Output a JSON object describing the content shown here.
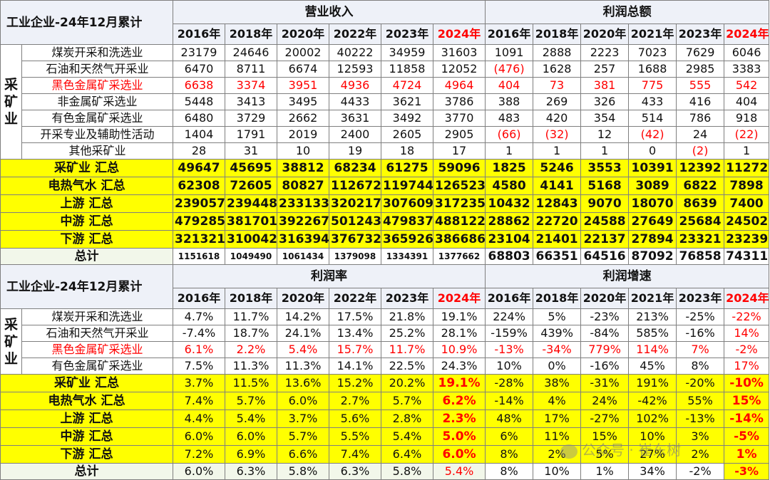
{
  "top": {
    "corner": "工业企业-24年12月累计",
    "group_revenue": "营业收入",
    "group_profit": "利润总额",
    "years_revenue": [
      "2016年",
      "2018年",
      "2020年",
      "2022年",
      "2023年",
      "2024年"
    ],
    "years_profit": [
      "2016年",
      "2018年",
      "2020年",
      "2021年",
      "2023年",
      "2024年"
    ],
    "side_label": "采矿业",
    "rows": [
      {
        "name": "煤炭开采和洗选业",
        "revenue": [
          "23179",
          "24646",
          "20002",
          "40222",
          "34959",
          "31603"
        ],
        "profit": [
          "1091",
          "2888",
          "2223",
          "7023",
          "7629",
          "6046"
        ]
      },
      {
        "name": "石油和天然气开采业",
        "revenue": [
          "6470",
          "8711",
          "6674",
          "12593",
          "11858",
          "12052"
        ],
        "profit": [
          "(476)",
          "1628",
          "257",
          "1688",
          "2985",
          "3383"
        ]
      },
      {
        "name": "黑色金属矿采选业",
        "revenue": [
          "6638",
          "3374",
          "3951",
          "4936",
          "4724",
          "4964"
        ],
        "profit": [
          "404",
          "73",
          "381",
          "775",
          "555",
          "542"
        ]
      },
      {
        "name": "非金属矿采选业",
        "revenue": [
          "5448",
          "3413",
          "3495",
          "4433",
          "3621",
          "3786"
        ],
        "profit": [
          "388",
          "269",
          "326",
          "433",
          "416",
          "404"
        ]
      },
      {
        "name": "有色金属矿采选业",
        "revenue": [
          "6480",
          "3729",
          "2662",
          "3631",
          "3492",
          "3770"
        ],
        "profit": [
          "483",
          "420",
          "354",
          "514",
          "786",
          "918"
        ]
      },
      {
        "name": "开采专业及辅助性活动",
        "revenue": [
          "1404",
          "1791",
          "2019",
          "2400",
          "2605",
          "2905"
        ],
        "profit": [
          "(66)",
          "(32)",
          "12",
          "(42)",
          "24",
          "(22)"
        ]
      },
      {
        "name": "其他采矿业",
        "revenue": [
          "28",
          "31",
          "10",
          "19",
          "18",
          "17"
        ],
        "profit": [
          "1",
          "1",
          "1",
          "0",
          "(2)",
          "1"
        ]
      }
    ],
    "summary": [
      {
        "name": "采矿业 汇总",
        "revenue": [
          "49647",
          "45695",
          "38812",
          "68234",
          "61275",
          "59096"
        ],
        "profit": [
          "1825",
          "5246",
          "3553",
          "10391",
          "12392",
          "11272"
        ]
      },
      {
        "name": "电热气水 汇总",
        "revenue": [
          "62308",
          "72605",
          "80827",
          "112672",
          "119744",
          "126523"
        ],
        "profit": [
          "4580",
          "4141",
          "5168",
          "3089",
          "6822",
          "7898"
        ]
      },
      {
        "name": "上游 汇总",
        "revenue": [
          "239057",
          "239448",
          "233133",
          "320217",
          "307609",
          "317235"
        ],
        "profit": [
          "10432",
          "12843",
          "9070",
          "18070",
          "8639",
          "7400"
        ]
      },
      {
        "name": "中游 汇总",
        "revenue": [
          "479285",
          "381701",
          "392267",
          "501243",
          "479837",
          "488122"
        ],
        "profit": [
          "28862",
          "22720",
          "24588",
          "27649",
          "25684",
          "24502"
        ]
      },
      {
        "name": "下游 汇总",
        "revenue": [
          "321321",
          "310042",
          "316394",
          "376732",
          "365926",
          "386686"
        ],
        "profit": [
          "23104",
          "21401",
          "22137",
          "27894",
          "23321",
          "23239"
        ]
      }
    ],
    "total": {
      "name": "总计",
      "revenue": [
        "1151618",
        "1049490",
        "1061434",
        "1379098",
        "1334391",
        "1377662"
      ],
      "profit": [
        "68803",
        "66351",
        "64516",
        "87092",
        "76858",
        "74311"
      ]
    }
  },
  "bottom": {
    "corner": "工业企业-24年12月累计",
    "group_rate": "利润率",
    "group_growth": "利润增速",
    "years_rate": [
      "2016年",
      "2018年",
      "2020年",
      "2022年",
      "2023年",
      "2024年"
    ],
    "years_growth": [
      "2016年",
      "2018年",
      "2020年",
      "2021年",
      "2023年",
      "2024年"
    ],
    "side_label": "采矿业",
    "rows": [
      {
        "name": "煤炭开采和洗选业",
        "rate": [
          "4.7%",
          "11.7%",
          "14.2%",
          "17.5%",
          "21.8%",
          "19.1%"
        ],
        "growth": [
          "224%",
          "5%",
          "-23%",
          "213%",
          "-25%",
          "-22%"
        ]
      },
      {
        "name": "石油和天然气开采业",
        "rate": [
          "-7.4%",
          "18.7%",
          "24.1%",
          "13.4%",
          "25.2%",
          "28.1%"
        ],
        "growth": [
          "-159%",
          "439%",
          "-84%",
          "585%",
          "-16%",
          "14%"
        ]
      },
      {
        "name": "黑色金属矿采选业",
        "rate": [
          "6.1%",
          "2.2%",
          "5.4%",
          "15.7%",
          "11.7%",
          "10.9%"
        ],
        "growth": [
          "-13%",
          "-34%",
          "779%",
          "114%",
          "7%",
          "-2%"
        ]
      },
      {
        "name": "有色金属矿采选业",
        "rate": [
          "7.5%",
          "11.3%",
          "11.3%",
          "14.1%",
          "22.5%",
          "24.3%"
        ],
        "growth": [
          "10%",
          "0%",
          "-16%",
          "45%",
          "8%",
          "17%"
        ]
      }
    ],
    "summary": [
      {
        "name": "采矿业 汇总",
        "rate": [
          "3.7%",
          "11.5%",
          "13.6%",
          "15.2%",
          "20.2%",
          "19.1%"
        ],
        "growth": [
          "-28%",
          "38%",
          "-31%",
          "191%",
          "-20%",
          "-10%"
        ]
      },
      {
        "name": "电热气水 汇总",
        "rate": [
          "7.4%",
          "5.7%",
          "6.0%",
          "2.7%",
          "5.7%",
          "6.2%"
        ],
        "growth": [
          "-14%",
          "4%",
          "24%",
          "-42%",
          "55%",
          "15%"
        ]
      },
      {
        "name": "上游 汇总",
        "rate": [
          "4.4%",
          "5.4%",
          "3.7%",
          "5.6%",
          "2.8%",
          "2.3%"
        ],
        "growth": [
          "48%",
          "17%",
          "-27%",
          "102%",
          "-13%",
          "-14%"
        ]
      },
      {
        "name": "中游 汇总",
        "rate": [
          "6.0%",
          "6.0%",
          "5.7%",
          "5.5%",
          "5.4%",
          "5.0%"
        ],
        "growth": [
          "6%",
          "11%",
          "15%",
          "10%",
          "3%",
          "-5%"
        ]
      },
      {
        "name": "下游 汇总",
        "rate": [
          "7.2%",
          "6.9%",
          "6.6%",
          "7.4%",
          "6.4%",
          "6.0%"
        ],
        "growth": [
          "8%",
          "2%",
          "5%",
          "27%",
          "2%",
          "1%"
        ]
      }
    ],
    "total": {
      "name": "总计",
      "rate": [
        "6.0%",
        "6.3%",
        "5.8%",
        "6.3%",
        "5.8%",
        "5.4%"
      ],
      "growth": [
        "8%",
        "10%",
        "1%",
        "34%",
        "-2%",
        "-3%"
      ]
    }
  },
  "watermark": "公众号 · 崔东树",
  "colors": {
    "highlight": "#ffff00",
    "red": "#ff0000",
    "header_bg": "#eef1f8",
    "total_bg": "#f2f7ea"
  }
}
